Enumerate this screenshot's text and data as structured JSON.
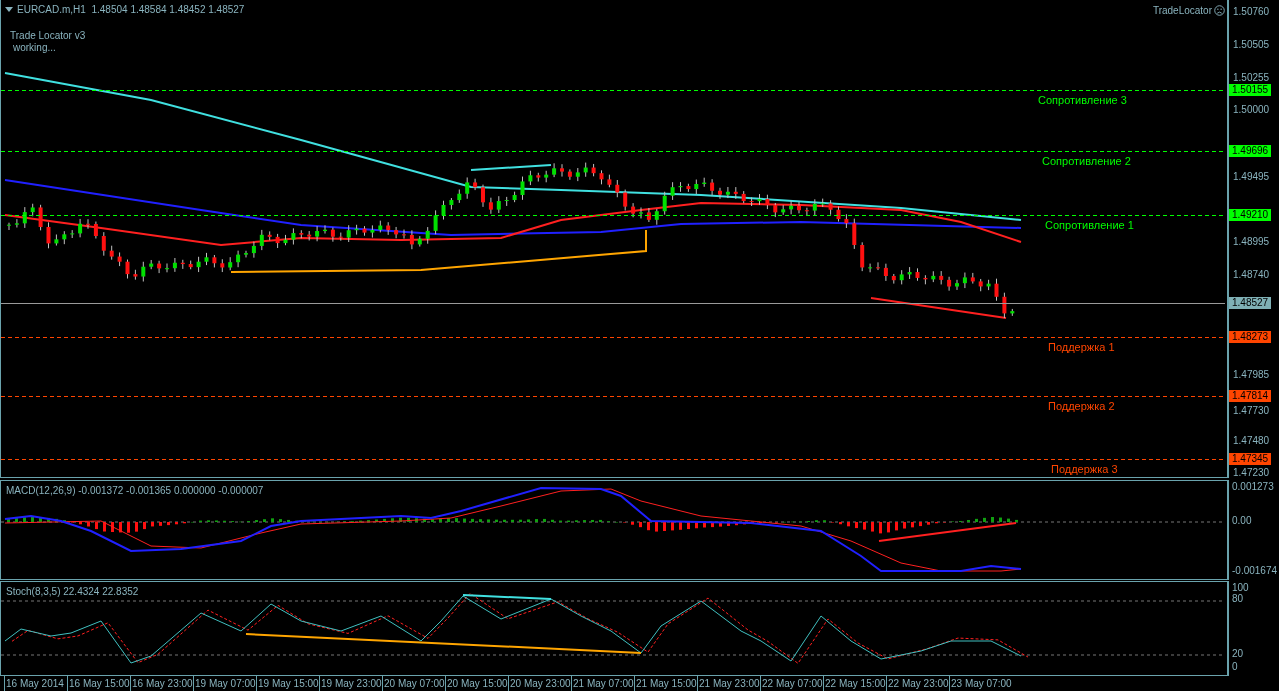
{
  "header": {
    "title": "EURCAD.m,H1  1.48504 1.48584 1.48452 1.48527"
  },
  "indicator": {
    "title": "Trade Locator v3",
    "status": "working...",
    "badge": "TradeLocator"
  },
  "price_axis": {
    "ticks": [
      "1.50760",
      "1.50505",
      "1.50255",
      "1.50000",
      "1.49495",
      "1.48995",
      "1.48740",
      "1.47985",
      "1.47730",
      "1.47480",
      "1.47230"
    ]
  },
  "levels": [
    {
      "label": "Сопротивление 3",
      "price": "1.50155",
      "color": "#00ff00"
    },
    {
      "label": "Сопротивление 2",
      "price": "1.49696",
      "color": "#00ff00"
    },
    {
      "label": "Сопротивление 1",
      "price": "1.49210",
      "color": "#00ff00"
    },
    {
      "label": "Поддержка 1",
      "price": "1.48273",
      "color": "#ff4500"
    },
    {
      "label": "Поддержка 2",
      "price": "1.47814",
      "color": "#ff4500"
    },
    {
      "label": "Поддержка 3",
      "price": "1.47345",
      "color": "#ff4500"
    }
  ],
  "current_price": "1.48527",
  "macd": {
    "label": "MACD(12,26,9) -0.001372 -0.001365 0.000000 -0.000007",
    "ticks": [
      "0.001273",
      "0.00",
      "-0.001674"
    ]
  },
  "stoch": {
    "label": "Stoch(8,3,5) 22.4324 22.8352",
    "ticks": [
      "100",
      "80",
      "20",
      "0"
    ]
  },
  "time_axis": [
    "16 May 2014",
    "16 May 15:00",
    "16 May 23:00",
    "19 May 07:00",
    "19 May 15:00",
    "19 May 23:00",
    "20 May 07:00",
    "20 May 15:00",
    "20 May 23:00",
    "21 May 07:00",
    "21 May 15:00",
    "21 May 23:00",
    "22 May 07:00",
    "22 May 15:00",
    "22 May 23:00",
    "23 May 07:00"
  ]
}
